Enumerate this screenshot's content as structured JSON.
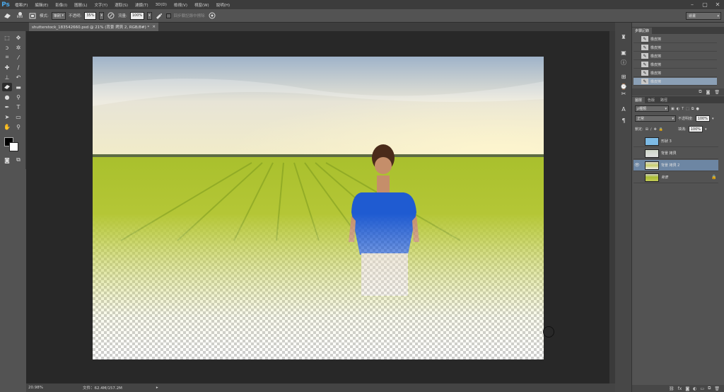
{
  "app": {
    "logo": "Ps"
  },
  "menu": [
    "檔案(F)",
    "編輯(E)",
    "影像(I)",
    "圖層(L)",
    "文字(Y)",
    "選取(S)",
    "濾鏡(T)",
    "3D(D)",
    "檢視(V)",
    "視窗(W)",
    "說明(H)"
  ],
  "window_controls": {
    "minimize": "–",
    "restore": "▢",
    "close": "✕"
  },
  "options": {
    "brush_size": "800",
    "mode_label": "模式:",
    "mode_value": "筆刷",
    "opacity_label": "不透明:",
    "opacity_value": "35%",
    "flow_label": "流量:",
    "flow_value": "100%",
    "history_erase_label": "回步驟記錄中擦除",
    "workspace": "繪畫"
  },
  "document": {
    "tab_title": "shutterstock_183542660.psd @ 21% (背景 拷貝 2, RGB/8#) *",
    "close": "×"
  },
  "status": {
    "zoom": "20.98%",
    "doc_info": "文件：62.4M/157.2M",
    "arrow": "▸"
  },
  "history_panel": {
    "tab": "步驟記錄",
    "items": [
      "橡皮擦",
      "橡皮擦",
      "橡皮擦",
      "橡皮擦",
      "橡皮擦",
      "橡皮擦"
    ]
  },
  "layers_panel": {
    "tabs": [
      "圖層",
      "色版",
      "路徑"
    ],
    "kind_filter": "ρ種類",
    "blend_mode": "正常",
    "opacity_label": "不透明度:",
    "opacity_value": "100%",
    "lock_label": "鎖定:",
    "fill_label": "填滿:",
    "fill_value": "100%",
    "layers": [
      {
        "name": "形狀 3",
        "visible": false,
        "selected": false,
        "locked": false
      },
      {
        "name": "背景 拷貝",
        "visible": false,
        "selected": false,
        "locked": false
      },
      {
        "name": "背景 拷貝 2",
        "visible": true,
        "selected": true,
        "locked": false
      },
      {
        "name": "背景",
        "visible": false,
        "selected": false,
        "locked": true
      }
    ]
  },
  "colors": {
    "foreground": "#000000",
    "background": "#ffffff",
    "selection": "#6d86a3",
    "history_selection": "#8ba0b6"
  }
}
